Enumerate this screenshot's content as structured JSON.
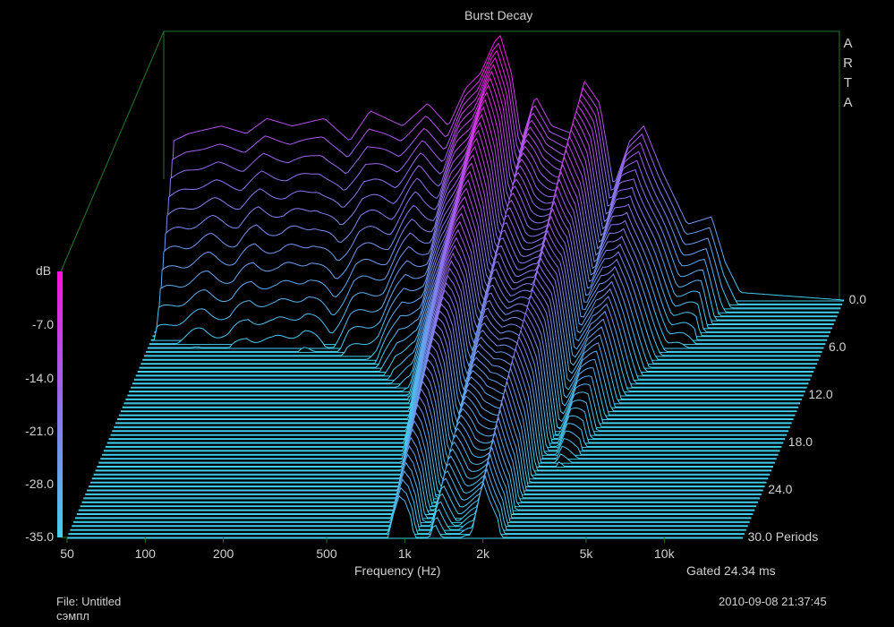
{
  "chart_data": {
    "type": "waterfall",
    "title": "Burst Decay",
    "xlabel": "Frequency (Hz)",
    "ylabel": "dB",
    "zlabel": "Periods",
    "xscale": "log",
    "xlim": [
      50,
      20000
    ],
    "ylim": [
      -35,
      0
    ],
    "zlim": [
      0,
      30
    ],
    "x_ticks": [
      {
        "value": 50,
        "label": "50"
      },
      {
        "value": 100,
        "label": "100"
      },
      {
        "value": 200,
        "label": "200"
      },
      {
        "value": 500,
        "label": "500"
      },
      {
        "value": 1000,
        "label": "1k"
      },
      {
        "value": 2000,
        "label": "2k"
      },
      {
        "value": 5000,
        "label": "5k"
      },
      {
        "value": 10000,
        "label": "10k"
      }
    ],
    "y_ticks": [
      {
        "value": -7,
        "label": "-7.0"
      },
      {
        "value": -14,
        "label": "-14.0"
      },
      {
        "value": -21,
        "label": "-21.0"
      },
      {
        "value": -28,
        "label": "-28.0"
      },
      {
        "value": -35,
        "label": "-35.0"
      }
    ],
    "z_ticks": [
      {
        "value": 0,
        "label": "0.0"
      },
      {
        "value": 6,
        "label": "6.0"
      },
      {
        "value": 12,
        "label": "12.0"
      },
      {
        "value": 18,
        "label": "18.0"
      },
      {
        "value": 24,
        "label": "24.0"
      },
      {
        "value": 30,
        "label": "30.0 Periods"
      }
    ],
    "initial_response_db": [
      [
        50,
        -35
      ],
      [
        52,
        -14
      ],
      [
        60,
        -13
      ],
      [
        80,
        -12
      ],
      [
        100,
        -13
      ],
      [
        120,
        -11
      ],
      [
        150,
        -12
      ],
      [
        200,
        -11
      ],
      [
        250,
        -14
      ],
      [
        300,
        -10
      ],
      [
        400,
        -12
      ],
      [
        500,
        -9
      ],
      [
        600,
        -12
      ],
      [
        700,
        -7
      ],
      [
        800,
        -5
      ],
      [
        900,
        -1
      ],
      [
        950,
        0
      ],
      [
        1050,
        -5
      ],
      [
        1150,
        -14
      ],
      [
        1300,
        -8
      ],
      [
        1500,
        -12
      ],
      [
        1800,
        -13
      ],
      [
        2000,
        -6
      ],
      [
        2300,
        -9
      ],
      [
        2600,
        -20
      ],
      [
        3000,
        -14
      ],
      [
        3400,
        -12
      ],
      [
        4000,
        -18
      ],
      [
        5000,
        -25
      ],
      [
        6200,
        -24
      ],
      [
        7000,
        -30
      ],
      [
        8000,
        -34
      ],
      [
        20000,
        -35
      ]
    ],
    "decay_rate_db_per_period": [
      [
        50,
        4
      ],
      [
        300,
        3.5
      ],
      [
        600,
        2
      ],
      [
        800,
        1.2
      ],
      [
        1000,
        0.9
      ],
      [
        1500,
        0.8
      ],
      [
        2000,
        0.7
      ],
      [
        3000,
        1
      ],
      [
        5000,
        1.5
      ],
      [
        10000,
        3
      ],
      [
        20000,
        3
      ]
    ],
    "slice_step_periods": 0.5,
    "colors": {
      "low": "#3fd0f0",
      "high": "#ff10e0",
      "frame": "#1f7a2a"
    }
  },
  "branding": "ARTA",
  "footer": {
    "file": "File: Untitled",
    "note": "сэмпл",
    "gated": "Gated 24.34 ms",
    "datetime": "2010-09-08  21:37:45"
  }
}
